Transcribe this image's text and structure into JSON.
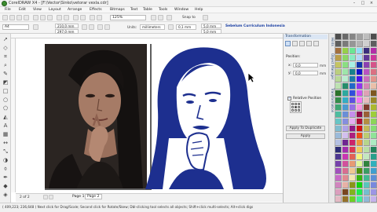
{
  "window": {
    "title": "CorelDRAW X4 - [F:\\Vector\\Sinko\\vetorar vexla.cdr]",
    "controls": [
      "–",
      "□",
      "×"
    ]
  },
  "menubar": {
    "items": [
      "File",
      "Edit",
      "View",
      "Layout",
      "Arrange",
      "Effects",
      "Bitmaps",
      "Text",
      "Table",
      "Tools",
      "Window",
      "Help"
    ]
  },
  "toolbar": {
    "zoom": "125%",
    "snap_label": "Snap to"
  },
  "property_bar": {
    "paper": "A4",
    "width": "210,0 mm",
    "height": "297,0 mm",
    "units_label": "Units:",
    "units_value": "millimeters",
    "nudge": "0,1 mm",
    "duplicate_x": "5,0 mm",
    "duplicate_y": "5,0 mm"
  },
  "watermark": "Sebelum Curriculum Indonesia",
  "pages": {
    "count": "2 of 2",
    "tabs": [
      "Page 1",
      "Page 2"
    ],
    "active_index": 1
  },
  "status": {
    "text": "( 409,223; 236,648 )   Next click for Drag/Scale; Second click for Rotate/Skew; Dbl-clicking tool selects all objects; Shift+click multi-selects; Alt+click digs"
  },
  "docker": {
    "title": "Transformation",
    "section_label": "Position:",
    "x_label": "x:",
    "x_value": "0,0",
    "y_label": "y:",
    "y_value": "0,0",
    "unit": "mm",
    "relative_label": "Relative Position",
    "relative_checked": true,
    "apply_duplicate": "Apply To Duplicate",
    "apply": "Apply"
  },
  "side_tabs": [
    "Hints",
    "Object Manager",
    "Transformation"
  ],
  "icons": {
    "app": "coreldraw-balloon-icon",
    "cursor": "arrow-cursor-icon"
  },
  "colors": {
    "vector_art": "#1d2f8f",
    "accent": "#1a3fa3"
  }
}
